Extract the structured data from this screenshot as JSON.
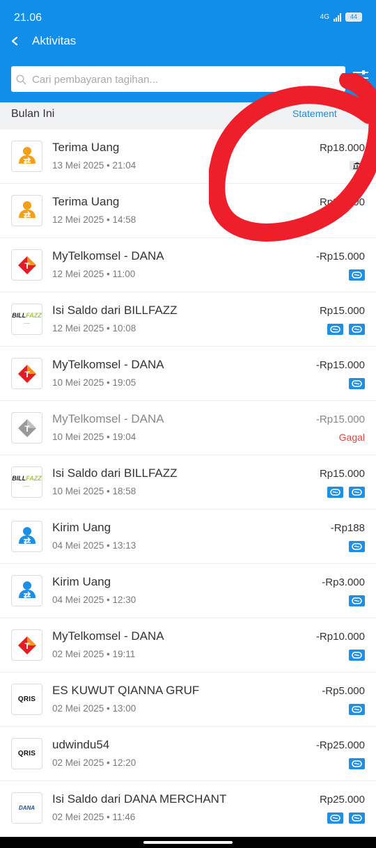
{
  "status_bar": {
    "time": "21.06",
    "network": "4G",
    "battery": "44"
  },
  "header": {
    "title": "Aktivitas",
    "search_placeholder": "Cari pembayaran tagihan..."
  },
  "section": {
    "label": "Bulan Ini",
    "statement_label": "Statement"
  },
  "colors": {
    "brand_blue": "#118ee9",
    "failed_red": "#e0463b",
    "annotation_red": "#ee1e2a"
  },
  "transactions": [
    {
      "icon": "receive-money-icon",
      "name": "Terima Uang",
      "date": "13 Mei 2025 • 21:04",
      "amount": "Rp18.000",
      "badges": [
        "bank"
      ]
    },
    {
      "icon": "receive-money-icon",
      "name": "Terima Uang",
      "date": "12 Mei 2025 • 14:58",
      "amount": "Rp32.000",
      "badges": []
    },
    {
      "icon": "telkomsel-icon",
      "name": "MyTelkomsel - DANA",
      "date": "12 Mei 2025 • 11:00",
      "amount": "-Rp15.000",
      "badges": [
        "dana"
      ]
    },
    {
      "icon": "billfazz-logo",
      "name": "Isi Saldo dari BILLFAZZ",
      "date": "12 Mei 2025 • 10:08",
      "amount": "Rp15.000",
      "badges": [
        "dana",
        "dana"
      ]
    },
    {
      "icon": "telkomsel-icon",
      "name": "MyTelkomsel - DANA",
      "date": "10 Mei 2025 • 19:05",
      "amount": "-Rp15.000",
      "badges": [
        "dana"
      ]
    },
    {
      "icon": "telkomsel-icon",
      "name": "MyTelkomsel - DANA",
      "date": "10 Mei 2025 • 19:04",
      "amount": "-Rp15.000",
      "status": "Gagal",
      "badges": []
    },
    {
      "icon": "billfazz-logo",
      "name": "Isi Saldo dari BILLFAZZ",
      "date": "10 Mei 2025 • 18:58",
      "amount": "Rp15.000",
      "badges": [
        "dana",
        "dana"
      ]
    },
    {
      "icon": "send-money-icon",
      "name": "Kirim Uang",
      "date": "04 Mei 2025 • 13:13",
      "amount": "-Rp188",
      "badges": [
        "dana"
      ]
    },
    {
      "icon": "send-money-icon",
      "name": "Kirim Uang",
      "date": "04 Mei 2025 • 12:30",
      "amount": "-Rp3.000",
      "badges": [
        "dana"
      ]
    },
    {
      "icon": "telkomsel-icon",
      "name": "MyTelkomsel - DANA",
      "date": "02 Mei 2025 • 19:11",
      "amount": "-Rp10.000",
      "badges": [
        "dana"
      ]
    },
    {
      "icon": "qris-logo",
      "name": "ES KUWUT QIANNA GRUF",
      "date": "02 Mei 2025 • 13:00",
      "amount": "-Rp5.000",
      "badges": [
        "dana"
      ]
    },
    {
      "icon": "qris-logo",
      "name": "udwindu54",
      "date": "02 Mei 2025 • 12:20",
      "amount": "-Rp25.000",
      "badges": [
        "dana"
      ]
    },
    {
      "icon": "dana-logo",
      "name": "Isi Saldo dari DANA MERCHANT",
      "date": "02 Mei 2025 • 11:46",
      "amount": "Rp25.000",
      "badges": [
        "dana",
        "dana"
      ]
    }
  ],
  "logos": {
    "billfazz_a": "BILL",
    "billfazz_b": "FAZZ",
    "qris": "QRIS",
    "dana": "DANA",
    "telkomsel_letter": "T"
  }
}
